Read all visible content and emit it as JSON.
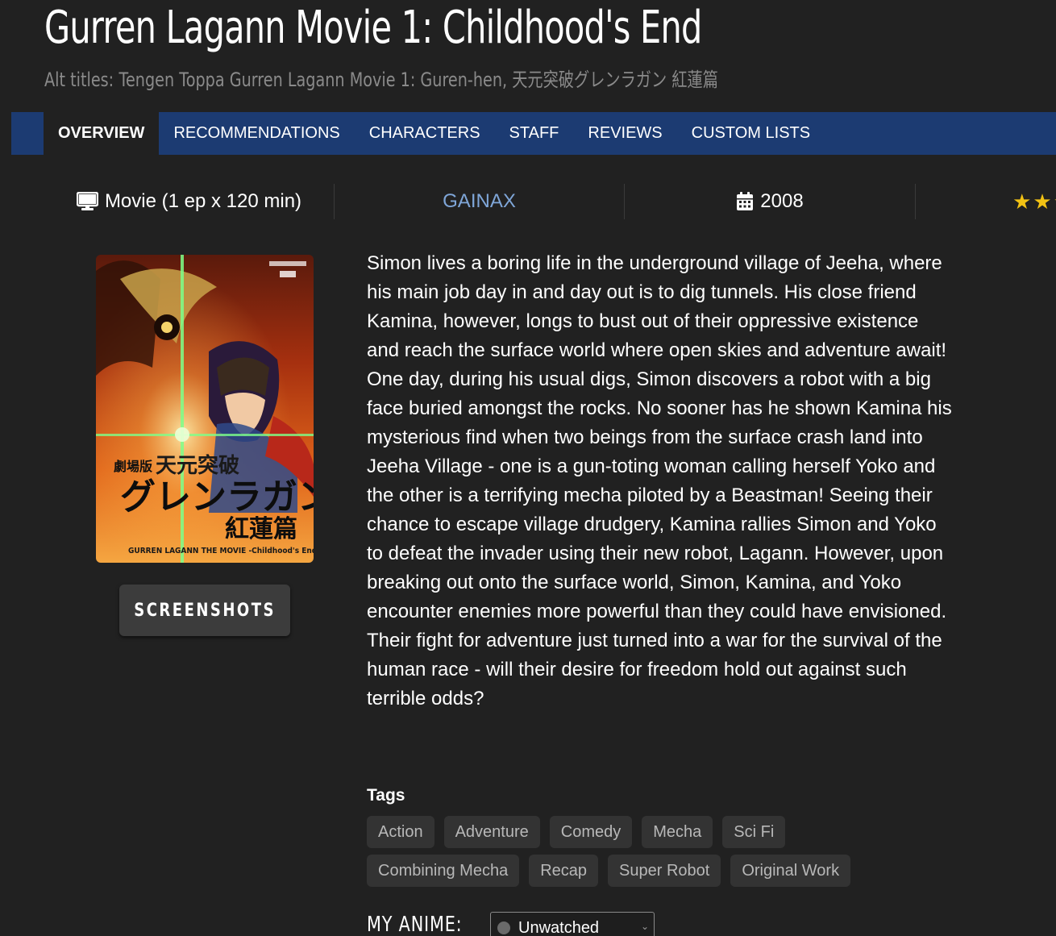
{
  "title": "Gurren Lagann Movie 1: Childhood's End",
  "alt_titles": {
    "prefix": "Alt titles:",
    "text": "Tengen Toppa Gurren Lagann Movie 1: Guren-hen, 天元突破グレンラガン 紅蓮篇"
  },
  "nav": {
    "tabs": [
      {
        "label": "OVERVIEW",
        "active": true
      },
      {
        "label": "RECOMMENDATIONS"
      },
      {
        "label": "CHARACTERS"
      },
      {
        "label": "STAFF"
      },
      {
        "label": "REVIEWS"
      },
      {
        "label": "CUSTOM LISTS"
      }
    ]
  },
  "info": {
    "type_icon": "monitor-icon",
    "type": "Movie (1 ep x 120 min)",
    "studio": "GAINAX",
    "year_icon": "calendar-icon",
    "year": "2008",
    "rating_stars_visible": 3,
    "star_color": "#f2c214"
  },
  "poster": {
    "lettering": {
      "top": "劇場版 天元突破",
      "main": "グレンラガン",
      "sub": "紅蓮篇",
      "bottom": "GURREN LAGANN THE MOVIE -Childhood's End-"
    }
  },
  "screenshots_button": "SCREENSHOTS",
  "synopsis": "Simon lives a boring life in the underground village of Jeeha, where his main job day in and day out is to dig tunnels. His close friend Kamina, however, longs to bust out of their oppressive existence and reach the surface world where open skies and adventure await! One day, during his usual digs, Simon discovers a robot with a big face buried amongst the rocks. No sooner has he shown Kamina his mysterious find when two beings from the surface crash land into Jeeha Village - one is a gun-toting woman calling herself Yoko and the other is a terrifying mecha piloted by a Beastman! Seeing their chance to escape village drudgery, Kamina rallies Simon and Yoko to defeat the invader using their new robot, Lagann. However, upon breaking out onto the surface world, Simon, Kamina, and Yoko encounter enemies more powerful than they could have envisioned. Their fight for adventure just turned into a war for the survival of the human race - will their desire for freedom hold out against such terrible odds?",
  "tags": {
    "label": "Tags",
    "items": [
      "Action",
      "Adventure",
      "Comedy",
      "Mecha",
      "Sci Fi",
      "Combining Mecha",
      "Recap",
      "Super Robot",
      "Original Work"
    ]
  },
  "my_anime": {
    "label": "MY ANIME:",
    "status": "Unwatched"
  },
  "colors": {
    "background": "#212121",
    "nav": "#1c3b72",
    "studio_link": "#7fa6d8"
  }
}
